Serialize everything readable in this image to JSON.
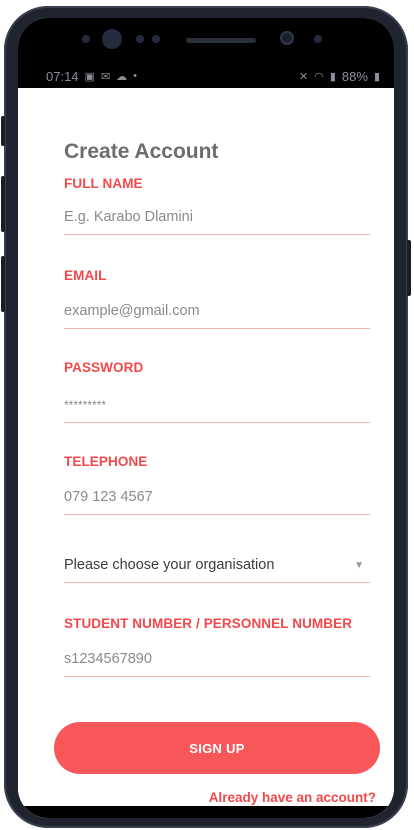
{
  "status_bar": {
    "time": "07:14",
    "left_icons": [
      "image-icon",
      "mail-icon",
      "cloud-icon",
      "dot-icon"
    ],
    "right_icons": [
      "mute-icon",
      "wifi-icon",
      "signal-icon",
      "battery-icon"
    ],
    "battery": "88%"
  },
  "page": {
    "title": "Create Account"
  },
  "form": {
    "full_name": {
      "label": "FULL NAME",
      "placeholder": "E.g. Karabo Dlamini"
    },
    "email": {
      "label": "EMAIL",
      "placeholder": "example@gmail.com"
    },
    "password": {
      "label": "PASSWORD",
      "placeholder": "*********"
    },
    "telephone": {
      "label": "TELEPHONE",
      "placeholder": "079 123 4567"
    },
    "organisation": {
      "placeholder": "Please choose your organisation"
    },
    "student_number": {
      "label": "STUDENT NUMBER / PERSONNEL NUMBER",
      "placeholder": "s1234567890"
    }
  },
  "actions": {
    "signup_label": "SIGN UP",
    "login_link": "Already have an account?"
  },
  "colors": {
    "accent": "#f2494d",
    "button": "#f8575a",
    "underline": "#f3b3b3",
    "frame": "#1f2430"
  }
}
